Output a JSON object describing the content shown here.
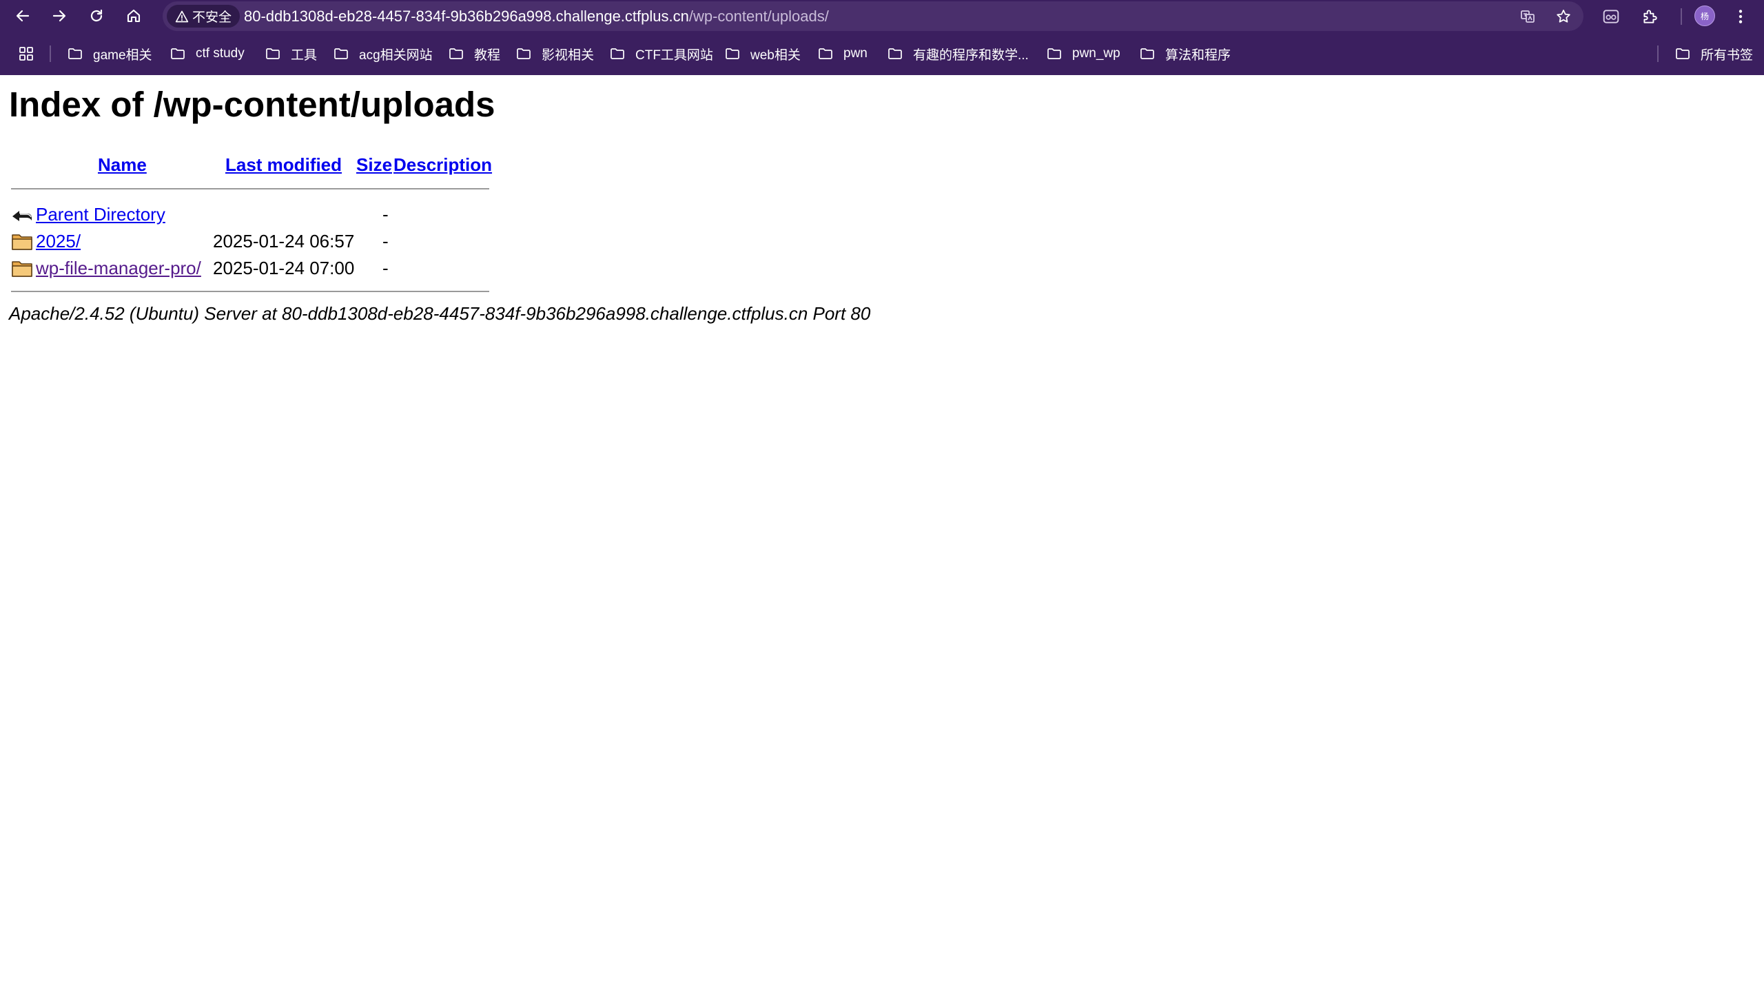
{
  "browser": {
    "security_label": "不安全",
    "url_host": "80-ddb1308d-eb28-4457-834f-9b36b296a998.challenge.ctfplus.cn",
    "url_path": "/wp-content/uploads/",
    "avatar_initial": "杨",
    "chrome_color": "#3b1f5f"
  },
  "bookmarks": {
    "items": [
      {
        "label": "game相关",
        "icon": "folder-icon"
      },
      {
        "label": "ctf study",
        "icon": "folder-icon"
      },
      {
        "label": "工具",
        "icon": "folder-icon"
      },
      {
        "label": "acg相关网站",
        "icon": "folder-icon"
      },
      {
        "label": "教程",
        "icon": "folder-icon"
      },
      {
        "label": "影视相关",
        "icon": "folder-icon"
      },
      {
        "label": "CTF工具网站",
        "icon": "folder-icon"
      },
      {
        "label": "web相关",
        "icon": "folder-icon"
      },
      {
        "label": "pwn",
        "icon": "folder-icon"
      },
      {
        "label": "有趣的程序和数学...",
        "icon": "folder-icon"
      },
      {
        "label": "pwn_wp",
        "icon": "folder-icon"
      },
      {
        "label": "算法和程序",
        "icon": "folder-icon"
      }
    ],
    "all_bookmarks": "所有书签"
  },
  "page": {
    "title": "Index of /wp-content/uploads",
    "headers": {
      "name": "Name",
      "last_modified": "Last modified",
      "size": "Size",
      "description": "Description"
    },
    "rows": [
      {
        "name": "Parent Directory",
        "modified": "",
        "size": "-",
        "icon": "back-arrow-icon"
      },
      {
        "name": "2025/",
        "modified": "2025-01-24 06:57",
        "size": "-",
        "icon": "folder-icon"
      },
      {
        "name": "wp-file-manager-pro/",
        "modified": "2025-01-24 07:00",
        "size": "-",
        "icon": "folder-icon"
      }
    ],
    "footer": "Apache/2.4.52 (Ubuntu) Server at 80-ddb1308d-eb28-4457-834f-9b36b296a998.challenge.ctfplus.cn Port 80"
  }
}
